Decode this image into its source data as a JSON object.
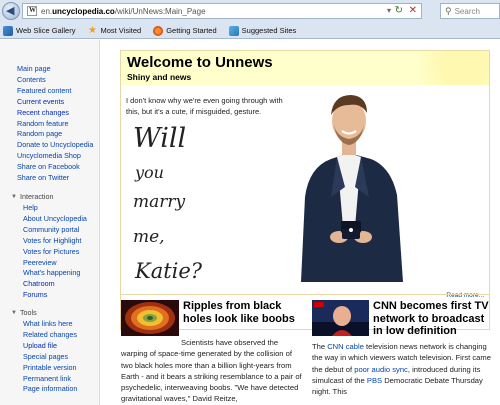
{
  "browser": {
    "url_prefix": "en.",
    "url_domain": "uncyclopedia.co",
    "url_path": "/wiki/UnNews:Main_Page",
    "search_placeholder": "Search"
  },
  "favorites": [
    {
      "label": "Web Slice Gallery"
    },
    {
      "label": "Most Visited"
    },
    {
      "label": "Getting Started"
    },
    {
      "label": "Suggested Sites"
    }
  ],
  "sidebar": {
    "main": [
      "Main page",
      "Contents",
      "Featured content",
      "Current events",
      "Recent changes",
      "Random feature",
      "Random page",
      "Donate to Uncyclopedia",
      "Uncyclomedia Shop",
      "Share on Facebook",
      "Share on Twitter"
    ],
    "interaction_title": "Interaction",
    "interaction": [
      "Help",
      "About Uncyclopedia",
      "Community portal",
      "Votes for Highlight",
      "Votes for Pictures",
      "Peereview",
      "What's happening",
      "Chatroom",
      "Forums"
    ],
    "tools_title": "Tools",
    "tools": [
      "What links here",
      "Related changes",
      "Upload file",
      "Special pages",
      "Printable version",
      "Permanent link",
      "Page information"
    ]
  },
  "welcome": {
    "title": "Welcome to Unnews",
    "subtitle": "Shiny and news",
    "intro": "I don't know why we're even going through with this, but it's a cute, if misguided, gesture.",
    "script_words": [
      "Will",
      "you",
      "marry",
      "me,",
      "Katie?"
    ],
    "read_more": "Read more..."
  },
  "news": [
    {
      "title": "Ripples from black holes look like boobs",
      "body_prefix": "Scientists have observed the warping of space-time generated by the collision of two black holes more than a billion light-years from Earth - and it bears a striking resemblance to a pair of psychedelic, interweaving boobs. \"We have detected gravitational waves,\" David Reitze,"
    },
    {
      "title": "CNN becomes first TV network to broadcast in low definition",
      "body_1": "The ",
      "link_1": "CNN cable",
      "body_2": " television news network is changing the way in which viewers watch television. First came the debut of ",
      "link_2": "poor audio sync",
      "body_3": ", introduced during its simulcast of the ",
      "link_3": "PBS",
      "body_4": " Democratic Debate Thursday night. This"
    }
  ],
  "colors": {
    "link": "#0645ad",
    "welcome_bg": "#ffffcc",
    "chrome_bg": "#dbe5f1"
  }
}
